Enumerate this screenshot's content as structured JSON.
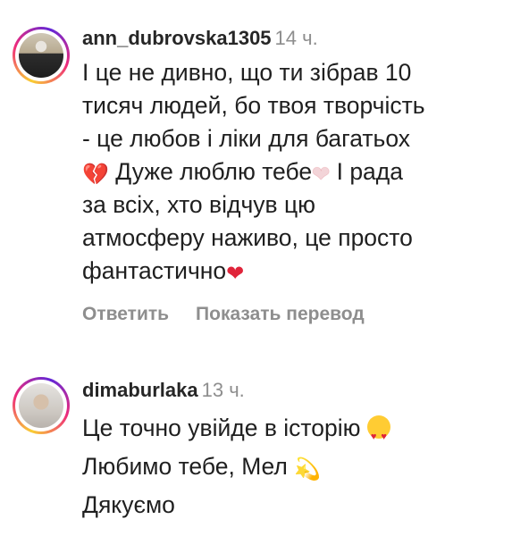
{
  "comments": [
    {
      "username": "ann_dubrovska1305",
      "time": "14 ч.",
      "lines": [
        "І це не дивно, що ти зібрав 10",
        "тисяч людей, бо твоя творчість",
        "- це любов і ліки для багатьох"
      ],
      "line4_emoji1": "💔",
      "line4_text1": "Дуже люблю тебе",
      "line4_emoji2": "❤",
      "line4_text2": "І рада",
      "line5": "за всіх, хто відчув цю",
      "line6": "атмосферу наживо, це просто",
      "line7_text": "фантастично",
      "line7_emoji": "❤",
      "reply_label": "Ответить",
      "translate_label": "Показать перевод"
    },
    {
      "username": "dimaburlaka",
      "time": "13 ч.",
      "line1_text": "Це точно увійде в історію",
      "line2_text": "Любимо тебе, Мел",
      "line2_emoji": "💫",
      "line3_text": "Дякуємо"
    }
  ],
  "icons": {
    "avatar1": "user-avatar-photo",
    "avatar2": "user-avatar-photo",
    "emoji_broken_heart": "broken-heart-icon",
    "emoji_heart": "heart-icon",
    "emoji_heart_eyes": "heart-eyes-icon",
    "emoji_dizzy": "dizzy-icon"
  }
}
